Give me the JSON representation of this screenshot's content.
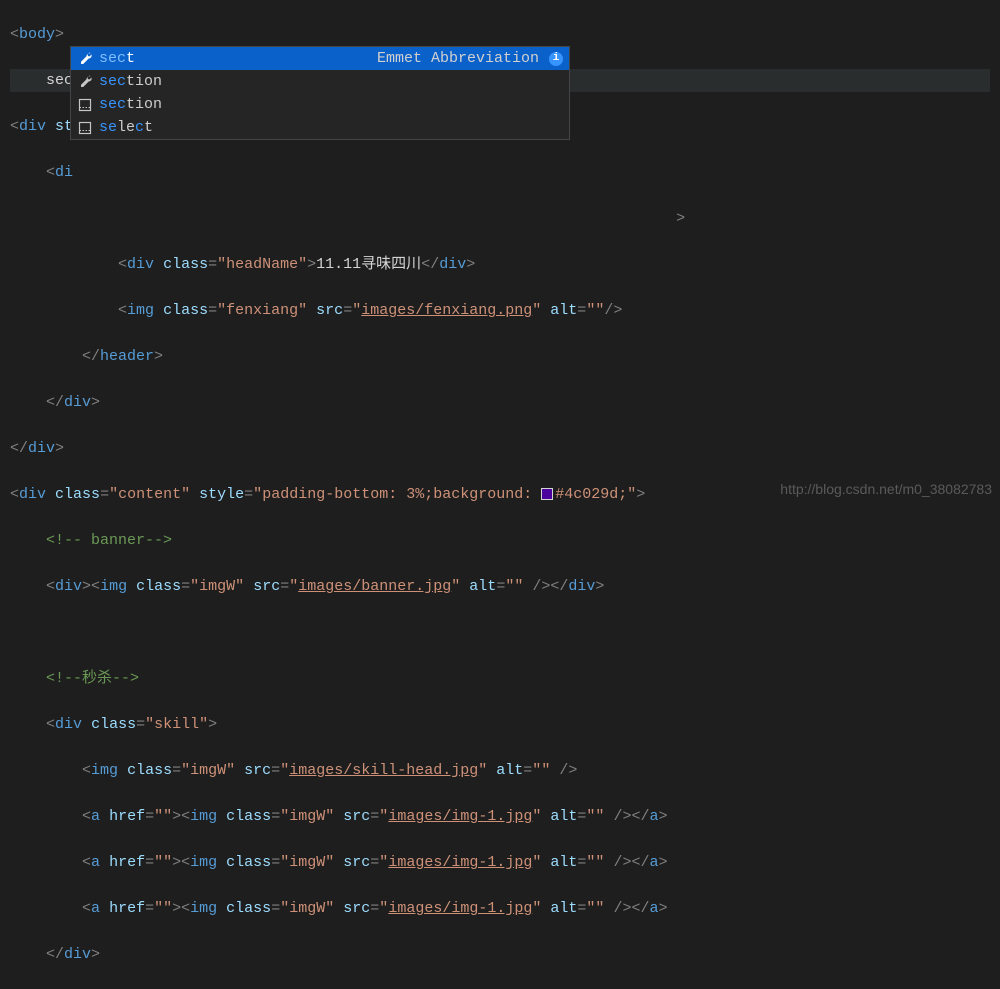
{
  "typed": "sec",
  "autocomplete": {
    "detail": "Emmet Abbreviation",
    "items": [
      {
        "label_parts": [
          "sec",
          "t"
        ],
        "match_pattern": "mmmp",
        "icon": "wrench",
        "selected": true
      },
      {
        "label_parts": [
          "sec",
          "tion"
        ],
        "match_pattern": "mmmpppp",
        "icon": "wrench",
        "selected": false
      },
      {
        "label_parts": [
          "sec",
          "tion"
        ],
        "match_pattern": "mmmpppp",
        "icon": "snippet",
        "selected": false
      },
      {
        "label_parts": [
          "se",
          "le",
          "c",
          "t"
        ],
        "match_pattern": "mmppmp",
        "icon": "snippet",
        "selected": false
      }
    ]
  },
  "code": {
    "body_open": "body",
    "div_st": "div",
    "st_attr": "st",
    "di_prefix": "di",
    "headName_line": {
      "tag": "div",
      "class_attr": "class",
      "class_val": "headName",
      "text": "11.11寻味四川"
    },
    "fenxiang_line": {
      "tag": "img",
      "class_attr": "class",
      "class_val": "fenxiang",
      "src_attr": "src",
      "src_val": "images/fenxiang.png",
      "alt_attr": "alt",
      "alt_val": ""
    },
    "header_close": "header",
    "div_close": "div",
    "content_line": {
      "tag": "div",
      "class_attr": "class",
      "class_val": "content",
      "style_attr": "style",
      "style_val_pre": "padding-bottom: 3%;background: ",
      "style_val_post": "#4c029d;"
    },
    "comment_banner": "<!-- banner-->",
    "banner_line": {
      "div": "div",
      "img": "img",
      "class_attr": "class",
      "class_val": "imgW",
      "src_attr": "src",
      "src_val": "images/banner.jpg",
      "alt_attr": "alt",
      "alt_val": ""
    },
    "comment_seckill": "<!--秒杀-->",
    "skill_line": {
      "tag": "div",
      "class_attr": "class",
      "class_val": "skill"
    },
    "skill_head": {
      "tag": "img",
      "class_attr": "class",
      "class_val": "imgW",
      "src_attr": "src",
      "src_val": "images/skill-head.jpg",
      "alt_attr": "alt",
      "alt_val": ""
    },
    "a_lines": [
      {
        "a": "a",
        "href_attr": "href",
        "href_val": "",
        "img": "img",
        "class_attr": "class",
        "class_val": "imgW",
        "src_attr": "src",
        "src_val": "images/img-1.jpg",
        "alt_attr": "alt",
        "alt_val": ""
      },
      {
        "a": "a",
        "href_attr": "href",
        "href_val": "",
        "img": "img",
        "class_attr": "class",
        "class_val": "imgW",
        "src_attr": "src",
        "src_val": "images/img-1.jpg",
        "alt_attr": "alt",
        "alt_val": ""
      },
      {
        "a": "a",
        "href_attr": "href",
        "href_val": "",
        "img": "img",
        "class_attr": "class",
        "class_val": "imgW",
        "src_attr": "src",
        "src_val": "images/img-1.jpg",
        "alt_attr": "alt",
        "alt_val": ""
      }
    ]
  },
  "watermark": "http://blog.csdn.net/m0_38082783"
}
